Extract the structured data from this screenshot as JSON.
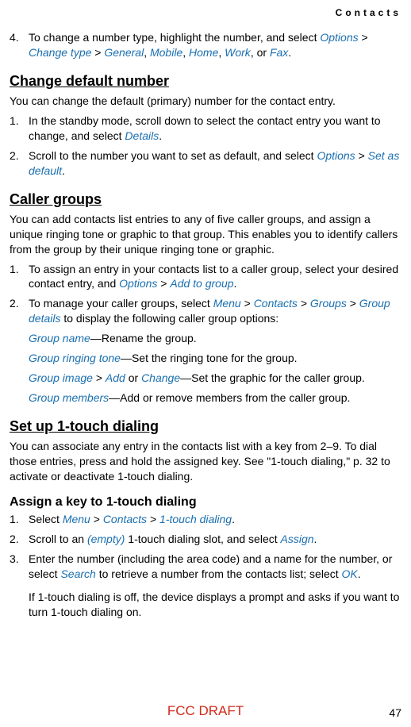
{
  "header": {
    "label": "Contacts"
  },
  "step4": {
    "num": "4.",
    "pre": "To change a number type, highlight the number, and select ",
    "options": "Options",
    "gt1": " > ",
    "changeType": "Change type",
    "gt2": " > ",
    "general": "General",
    "c1": ", ",
    "mobile": "Mobile",
    "c2": ", ",
    "home": "Home",
    "c3": ", ",
    "work": "Work",
    "c4": ", or ",
    "fax": "Fax",
    "end": "."
  },
  "changeDefault": {
    "heading": "Change default number",
    "intro": "You can change the default (primary) number for the contact entry.",
    "s1": {
      "num": "1.",
      "pre": "In the standby mode, scroll down to select the contact entry you want to change, and select ",
      "details": "Details",
      "end": "."
    },
    "s2": {
      "num": "2.",
      "pre": "Scroll to the number you want to set as default, and select ",
      "options": "Options",
      "gt": " > ",
      "setDefault": "Set as default",
      "end": "."
    }
  },
  "callerGroups": {
    "heading": "Caller groups",
    "intro": "You can add contacts list entries to any of five caller groups, and assign a unique ringing tone or graphic to that group. This enables you to identify callers from the group by their unique ringing tone or graphic.",
    "s1": {
      "num": "1.",
      "pre": "To assign an entry in your contacts list to a caller group, select your desired contact entry, and ",
      "options": "Options",
      "gt": " > ",
      "addToGroup": "Add to group",
      "end": "."
    },
    "s2": {
      "num": "2.",
      "pre": "To manage your caller groups, select ",
      "menu": "Menu",
      "gt1": " > ",
      "contacts": "Contacts",
      "gt2": " > ",
      "groups": "Groups",
      "gt3": " > ",
      "groupDetails": "Group details",
      "post": " to display the following caller group options:"
    },
    "opt1": {
      "name": "Group name",
      "desc": "—Rename the group."
    },
    "opt2": {
      "name": "Group ringing tone",
      "desc": "—Set the ringing tone for the group."
    },
    "opt3": {
      "name": "Group image",
      "gt": " > ",
      "add": "Add",
      "or": " or ",
      "change": "Change",
      "desc": "—Set the graphic for the caller group."
    },
    "opt4": {
      "name": "Group members",
      "desc": "—Add or remove members from the caller group."
    }
  },
  "oneTouch": {
    "heading": "Set up 1-touch dialing",
    "intro": "You can associate any entry in the contacts list with a key from 2–9. To dial those entries, press and hold the assigned key. See \"1-touch dialing,\" p. 32 to activate or deactivate 1-touch dialing.",
    "assignHeading": "Assign a key to 1-touch dialing",
    "s1": {
      "num": "1.",
      "pre": "Select ",
      "menu": "Menu",
      "gt1": " > ",
      "contacts": "Contacts",
      "gt2": " > ",
      "oneTouch": "1-touch dialing",
      "end": "."
    },
    "s2": {
      "num": "2.",
      "pre": "Scroll to an ",
      "empty": "(empty)",
      "mid": " 1-touch dialing slot, and select ",
      "assign": "Assign",
      "end": "."
    },
    "s3": {
      "num": "3.",
      "pre": "Enter the number (including the area code) and a name for the number, or select ",
      "search": "Search",
      "mid": " to retrieve a number from the contacts list; select ",
      "ok": "OK",
      "end": ".",
      "note": "If 1-touch dialing is off, the device displays a prompt and asks if you want to turn 1-touch dialing on."
    }
  },
  "footer": {
    "draft": "FCC DRAFT",
    "page": "47"
  }
}
